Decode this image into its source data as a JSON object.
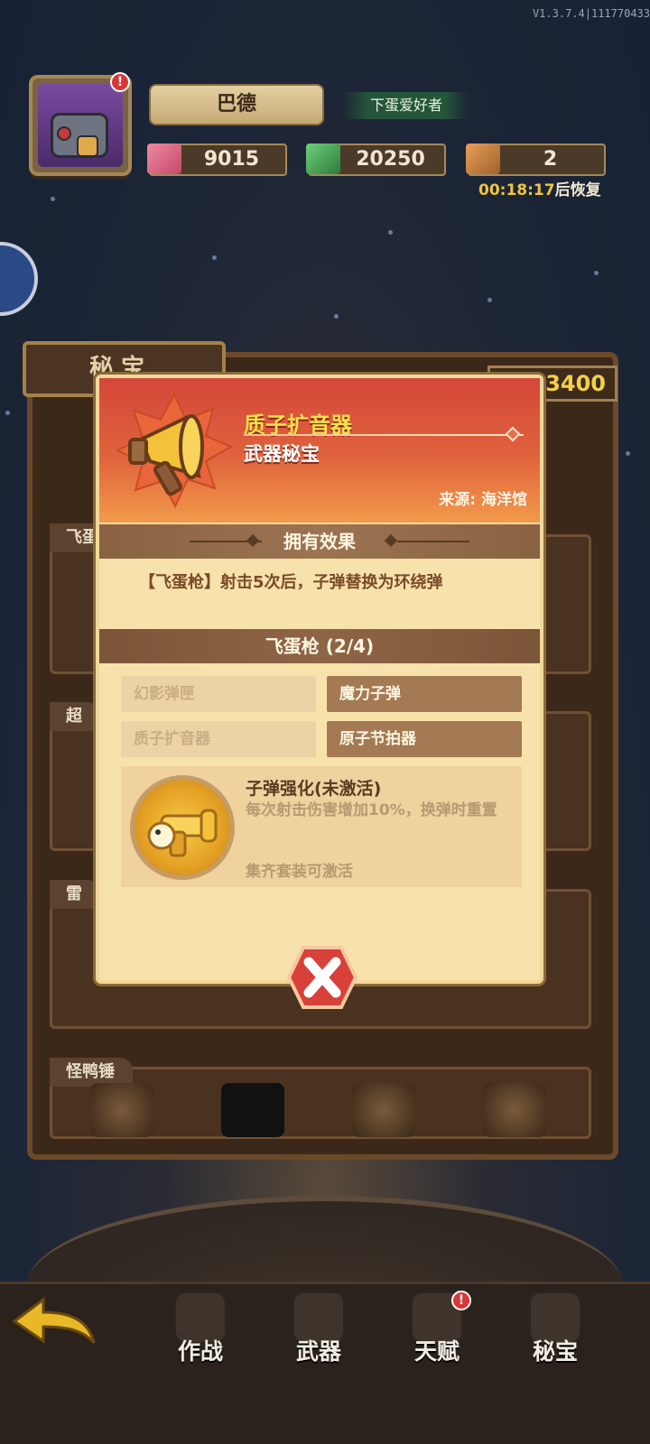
{
  "version": "V1.3.7.4|111770433",
  "player": {
    "name": "巴德",
    "title": "下蛋爱好者",
    "avatar_alert": "!"
  },
  "resources": {
    "gems": "9015",
    "cash": "20250",
    "tickets": "2",
    "timer": "00:18:17",
    "timer_suffix": "后恢复"
  },
  "panel": {
    "tab_title": "秘 宝",
    "counter": "3400",
    "rows": [
      "飞蛋",
      "超",
      "雷",
      "怪鸭锤"
    ]
  },
  "modal": {
    "item_name": "质子扩音器",
    "item_type": "武器秘宝",
    "source": "来源: 海洋馆",
    "effect_header": "拥有效果",
    "effect_text": "【飞蛋枪】射击5次后，子弹替换为环绕弹",
    "set_header": "飞蛋枪 (2/4)",
    "set_items": [
      {
        "label": "幻影弹匣",
        "owned": false
      },
      {
        "label": "魔力子弹",
        "owned": true
      },
      {
        "label": "质子扩音器",
        "owned": false
      },
      {
        "label": "原子节拍器",
        "owned": true
      }
    ],
    "bonus": {
      "title": "子弹强化(未激活)",
      "desc": "每次射击伤害增加10%，换弹时重置",
      "note": "集齐套装可激活"
    }
  },
  "nav": {
    "items": [
      {
        "label": "作战",
        "alert": false
      },
      {
        "label": "武器",
        "alert": false
      },
      {
        "label": "天赋",
        "alert": true
      },
      {
        "label": "秘宝",
        "alert": false
      }
    ],
    "alert_mark": "!"
  },
  "colors": {
    "header_red": "#d4473a",
    "name_yellow": "#f6e14a",
    "panel_cream": "#f8e2ab",
    "section_brown": "#8a6242",
    "timer_gold": "#f2c43a"
  },
  "icons": {
    "item": "megaphone-icon",
    "bonus": "golden-blaster-icon",
    "close": "close-x-icon",
    "back": "back-arrow-icon"
  }
}
